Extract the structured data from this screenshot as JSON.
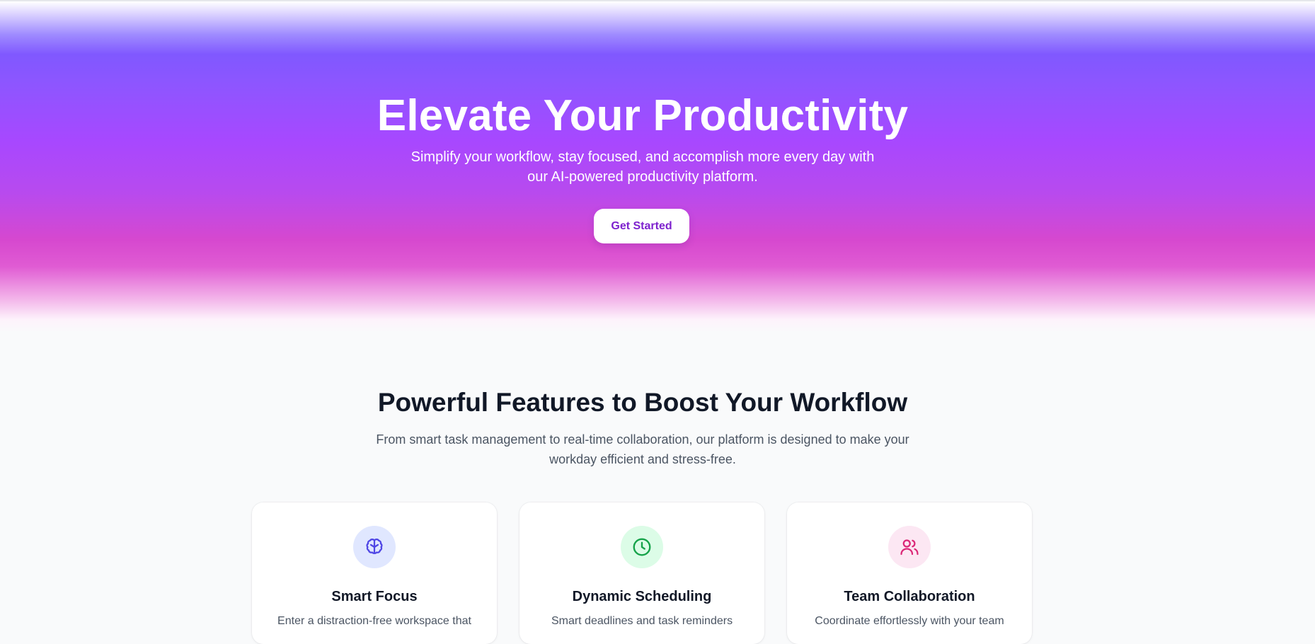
{
  "hero": {
    "title": "Elevate Your Productivity",
    "subtitle_line1": "Simplify your workflow, stay focused, and accomplish more every day with",
    "subtitle_line2": "our AI-powered productivity platform.",
    "cta_label": "Get Started"
  },
  "features": {
    "title": "Powerful Features to Boost Your Workflow",
    "subtitle_line1": "From smart task management to real-time collaboration, our platform is designed to make your",
    "subtitle_line2": "workday efficient and stress-free.",
    "cards": [
      {
        "icon": "brain-icon",
        "icon_color": "#4f46e5",
        "icon_bg": "#e0e7ff",
        "title": "Smart Focus",
        "description": "Enter a distraction-free workspace that"
      },
      {
        "icon": "clock-icon",
        "icon_color": "#16a34a",
        "icon_bg": "#dcfce7",
        "title": "Dynamic Scheduling",
        "description": "Smart deadlines and task reminders"
      },
      {
        "icon": "users-icon",
        "icon_color": "#db2777",
        "icon_bg": "#fce7f3",
        "title": "Team Collaboration",
        "description": "Coordinate effortlessly with your team"
      }
    ]
  },
  "colors": {
    "accent_purple": "#8b5cf6",
    "accent_pink": "#d946ef",
    "cta_text": "#7e22ce"
  }
}
